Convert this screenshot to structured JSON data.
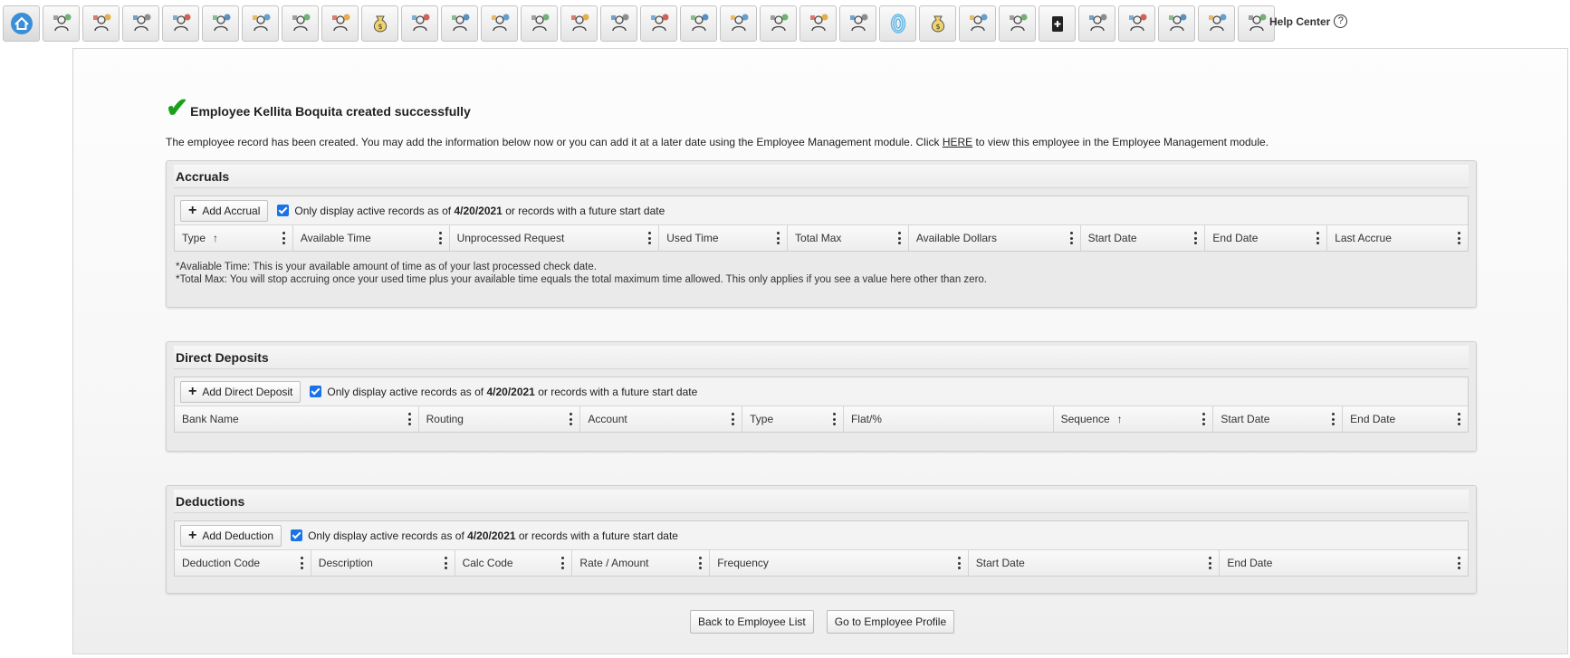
{
  "toolbar": {
    "icons": [
      "home-icon",
      "person-badge-icon",
      "person-gears-icon",
      "presentation-icon",
      "team-icon",
      "org-chart-icon",
      "document-edit-icon",
      "growth-chart-icon",
      "target-cycle-icon",
      "money-bag-icon",
      "person-search-icon",
      "target-cycle-icon",
      "target-cycle-icon",
      "growth-chart-icon",
      "target-cycle-icon",
      "transfer-arrows-icon",
      "idea-person-icon",
      "shield-person-icon",
      "award-person-icon",
      "transfer-arrows-icon",
      "hand-money-icon",
      "person-x-icon",
      "fingerprint-icon",
      "money-bag-icon",
      "idea-person-icon",
      "people-coins-icon",
      "clipboard-plus-icon",
      "shield-person-icon",
      "hand-money-icon",
      "gift-icon",
      "document-icon",
      "certificate-search-icon"
    ],
    "help_label": "Help Center",
    "help_symbol": "?"
  },
  "success": {
    "check": "✔",
    "message": "Employee Kellita Boquita created successfully"
  },
  "intro": {
    "before": "The employee record has been created. You may add the information below now or you can add it at a later date using the Employee Management module. Click ",
    "link": "HERE",
    "after": " to view this employee in the Employee Management module."
  },
  "filter": {
    "prefix": "Only display active records as of ",
    "date": "4/20/2021",
    "suffix": " or records with a future start date"
  },
  "accruals": {
    "title": "Accruals",
    "add_label": "Add Accrual",
    "columns": [
      "Type",
      "Available Time",
      "Unprocessed Request",
      "Used Time",
      "Total Max",
      "Available Dollars",
      "Start Date",
      "End Date",
      "Last Accrue"
    ],
    "sort_symbol": "↑",
    "note1": "*Avaliable Time: This is your available amount of time as of your last processed check date.",
    "note2": "*Total Max: You will stop accruing once your used time plus your available time equals the total maximum time allowed. This only applies if you see a value here other than zero."
  },
  "deposits": {
    "title": "Direct Deposits",
    "add_label": "Add Direct Deposit",
    "columns": [
      "Bank Name",
      "Routing",
      "Account",
      "Type",
      "Flat/%",
      "Sequence",
      "Start Date",
      "End Date"
    ],
    "sort_symbol": "↑"
  },
  "deductions": {
    "title": "Deductions",
    "add_label": "Add Deduction",
    "columns": [
      "Deduction Code",
      "Description",
      "Calc Code",
      "Rate / Amount",
      "Frequency",
      "Start Date",
      "End Date"
    ]
  },
  "buttons": {
    "back": "Back to Employee List",
    "profile": "Go to Employee Profile"
  }
}
